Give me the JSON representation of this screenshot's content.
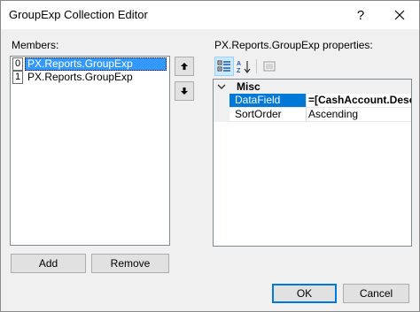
{
  "window": {
    "title": "GroupExp Collection Editor",
    "help_label": "?"
  },
  "members": {
    "label": "Members:",
    "items": [
      {
        "index": "0",
        "name": "PX.Reports.GroupExp",
        "selected": true
      },
      {
        "index": "1",
        "name": "PX.Reports.GroupExp",
        "selected": false
      }
    ],
    "add_label": "Add",
    "remove_label": "Remove"
  },
  "properties": {
    "label": "PX.Reports.GroupExp properties:",
    "toolbar": [
      "categorized-icon",
      "alphabetical-icon",
      "property-pages-icon"
    ],
    "category": "Misc",
    "rows": [
      {
        "name": "DataField",
        "value": "=[CashAccount.Desc",
        "bold": true
      },
      {
        "name": "SortOrder",
        "value": "Ascending",
        "bold": false
      }
    ]
  },
  "footer": {
    "ok_label": "OK",
    "cancel_label": "Cancel"
  },
  "colors": {
    "selection": "#3399ff",
    "grid_selection": "#0078d7",
    "dialog_bg": "#f0f0f0"
  }
}
